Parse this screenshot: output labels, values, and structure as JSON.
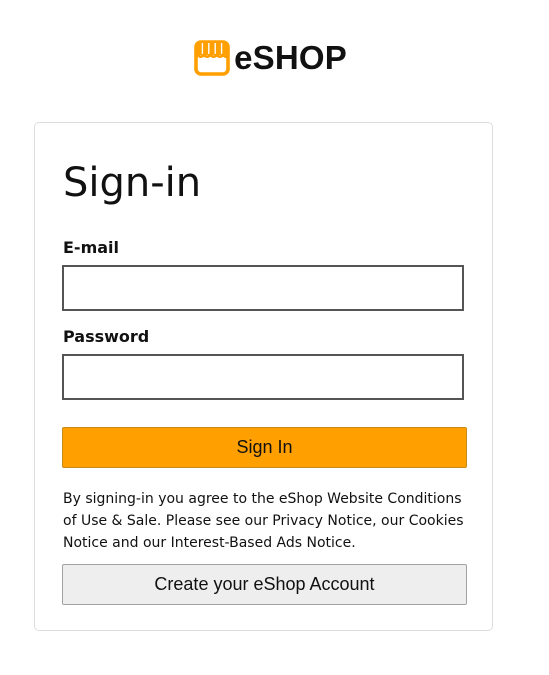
{
  "header": {
    "logo_icon": "storefront-icon",
    "brand": "eSHOP",
    "brand_color": "#ff9f00"
  },
  "signin": {
    "title": "Sign-in",
    "email_label": "E-mail",
    "email_value": "",
    "password_label": "Password",
    "password_value": "",
    "signin_button": "Sign In",
    "signin_button_color": "#ff9f00",
    "terms_text": "By signing-in you agree to the eShop Website Conditions of Use & Sale. Please see our Privacy Notice, our Cookies Notice and our Interest-Based Ads Notice.",
    "create_account_button": "Create your eShop Account",
    "create_account_button_color": "#eeeeee"
  }
}
